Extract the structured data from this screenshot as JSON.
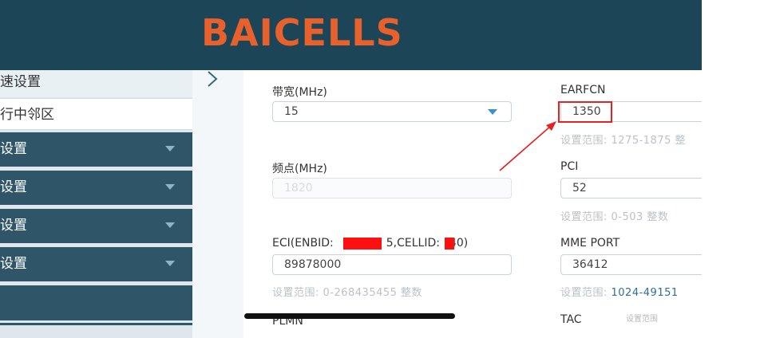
{
  "brand": {
    "logo_text": "BAICELLS",
    "accent": "#e8612c",
    "header_bg": "#1c4557"
  },
  "sidebar": {
    "items": [
      {
        "label": "速设置",
        "state": "light",
        "dropdown": false
      },
      {
        "label": "行中邻区",
        "state": "active",
        "dropdown": false
      },
      {
        "label": "设置",
        "state": "dark",
        "dropdown": true
      },
      {
        "label": "设置",
        "state": "dark",
        "dropdown": true
      },
      {
        "label": "设置",
        "state": "dark",
        "dropdown": true
      },
      {
        "label": "设置",
        "state": "dark",
        "dropdown": true
      },
      {
        "label": "",
        "state": "dark",
        "dropdown": false
      }
    ]
  },
  "form": {
    "bandwidth": {
      "label": "带宽(MHz)",
      "value": "15"
    },
    "earfcn": {
      "label": "EARFCN",
      "value": "1350",
      "hint": "设置范围: 1275-1875 整"
    },
    "frequency": {
      "label": "频点(MHz)",
      "value": "1820"
    },
    "pci": {
      "label": "PCI",
      "value": "52",
      "hint": "设置范围: 0-503 整数"
    },
    "eci": {
      "label_prefix": "ECI(ENBID:",
      "label_mid": "5,CELLID:",
      "label_suffix": "40)",
      "value": "89878000",
      "hint": "设置范围: 0-268435455 整数"
    },
    "mme_port": {
      "label": "MME PORT",
      "value": "36412",
      "hint_prefix": "设置范围: ",
      "hint_link": "1024-49151"
    },
    "plmn": {
      "label": "PLMN"
    },
    "tac": {
      "label": "TAC"
    }
  },
  "watermark": "设置范围"
}
